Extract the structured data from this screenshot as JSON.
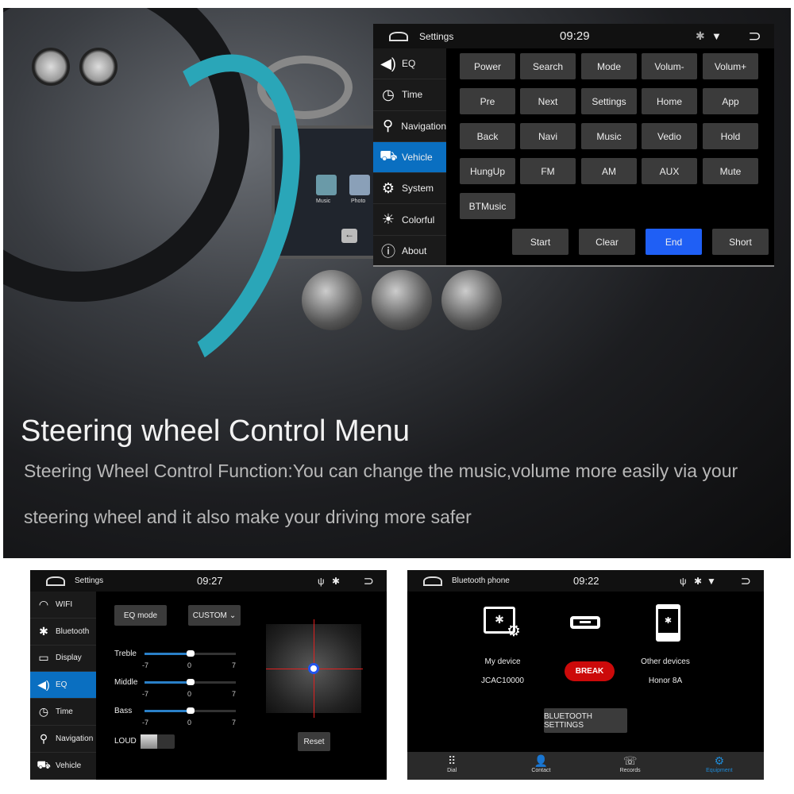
{
  "hero": {
    "headline": "Steering wheel Control Menu",
    "description_line1": "Steering Wheel Control Function:You can change the music,volume more easily via your",
    "description_line2": "steering wheel and it also make your driving more safer",
    "dash_screen_apps": [
      "Music",
      "Photo"
    ],
    "accent_color": "#2aa6b8"
  },
  "vehicle_panel": {
    "header": {
      "title": "Settings",
      "time": "09:29",
      "icons": [
        "home-icon",
        "bluetooth-icon",
        "wifi-icon",
        "back-icon"
      ]
    },
    "sidebar": [
      {
        "label": "EQ",
        "icon": "speaker-icon"
      },
      {
        "label": "Time",
        "icon": "clock-icon"
      },
      {
        "label": "Navigation",
        "icon": "location-pin-icon"
      },
      {
        "label": "Vehicle",
        "icon": "car-gear-icon",
        "selected": true
      },
      {
        "label": "System",
        "icon": "gear-icon"
      },
      {
        "label": "Colorful",
        "icon": "bulb-icon"
      },
      {
        "label": "About",
        "icon": "info-icon"
      }
    ],
    "keys": [
      [
        "Power",
        "Search",
        "Mode",
        "Volum-",
        "Volum+"
      ],
      [
        "Pre",
        "Next",
        "Settings",
        "Home",
        "App"
      ],
      [
        "Back",
        "Navi",
        "Music",
        "Vedio",
        "Hold"
      ],
      [
        "HungUp",
        "FM",
        "AM",
        "AUX",
        "Mute"
      ],
      [
        "BTMusic"
      ]
    ],
    "actions": [
      {
        "label": "Start"
      },
      {
        "label": "Clear"
      },
      {
        "label": "End",
        "active": true
      },
      {
        "label": "Short"
      }
    ],
    "active_color": "#1f5ff5"
  },
  "eq_panel": {
    "header": {
      "title": "Settings",
      "time": "09:27",
      "icons": [
        "home-icon",
        "usb-icon",
        "bluetooth-icon",
        "back-icon"
      ]
    },
    "sidebar": [
      {
        "label": "WIFI",
        "icon": "wifi-icon"
      },
      {
        "label": "Bluetooth",
        "icon": "bluetooth-icon"
      },
      {
        "label": "Display",
        "icon": "display-icon"
      },
      {
        "label": "EQ",
        "icon": "speaker-icon",
        "selected": true
      },
      {
        "label": "Time",
        "icon": "clock-icon"
      },
      {
        "label": "Navigation",
        "icon": "location-pin-icon"
      },
      {
        "label": "Vehicle",
        "icon": "car-gear-icon"
      }
    ],
    "eq_mode_label": "EQ mode",
    "eq_mode_value": "CUSTOM",
    "sliders": [
      {
        "label": "Treble",
        "min": "-7",
        "mid": "0",
        "max": "7",
        "value": 0
      },
      {
        "label": "Middle",
        "min": "-7",
        "mid": "0",
        "max": "7",
        "value": 0
      },
      {
        "label": "Bass",
        "min": "-7",
        "mid": "0",
        "max": "7",
        "value": 0
      }
    ],
    "loud_label": "LOUD",
    "loud_on": false,
    "reset_label": "Reset"
  },
  "bt_panel": {
    "header": {
      "title": "Bluetooth phone",
      "time": "09:22",
      "icons": [
        "home-icon",
        "usb-icon",
        "bluetooth-icon",
        "wifi-icon",
        "back-icon"
      ]
    },
    "my_device_label": "My device",
    "my_device_name": "JCAC10000",
    "break_label": "BREAK",
    "other_devices_label": "Other devices",
    "other_device_name": "Honor 8A",
    "settings_label": "BLUETOOTH SETTINGS",
    "break_color": "#cc0a0a",
    "nav": [
      {
        "label": "Dial",
        "icon": "dialpad-icon"
      },
      {
        "label": "Contact",
        "icon": "contact-icon"
      },
      {
        "label": "Records",
        "icon": "call-records-icon"
      },
      {
        "label": "Equipment",
        "icon": "gear-icon",
        "active": true
      }
    ],
    "active_color": "#1e8ad6"
  }
}
